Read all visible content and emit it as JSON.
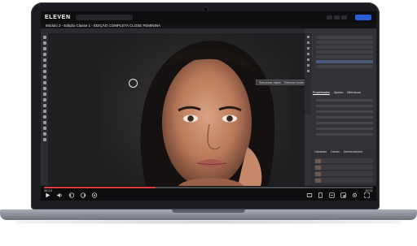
{
  "app": {
    "brand": "ELEVEN",
    "course_title": "Módulo 2 - Edição Classe 1 - EDIÇÃO COMPLETA CLOSE FEMININA"
  },
  "editor": {
    "floating_toolbar": [
      "Selecionar objeto",
      "Remover fundo"
    ],
    "properties_tabs": [
      "Propriedades",
      "Ajustes",
      "Bibliotecas"
    ],
    "layers_tabs": [
      "Camadas",
      "Canais",
      "Demarcadores"
    ]
  },
  "player": {
    "current_time": "06:13",
    "total_time": "18:01",
    "progress": 0.34
  },
  "colors": {
    "accent": "#2c5cd6",
    "progress": "#e23b3b",
    "lid": "#1b1c1f"
  },
  "icons": [
    "play-icon",
    "rewind-icon",
    "forward-icon",
    "volume-icon",
    "settings-icon",
    "fullscreen-icon"
  ]
}
